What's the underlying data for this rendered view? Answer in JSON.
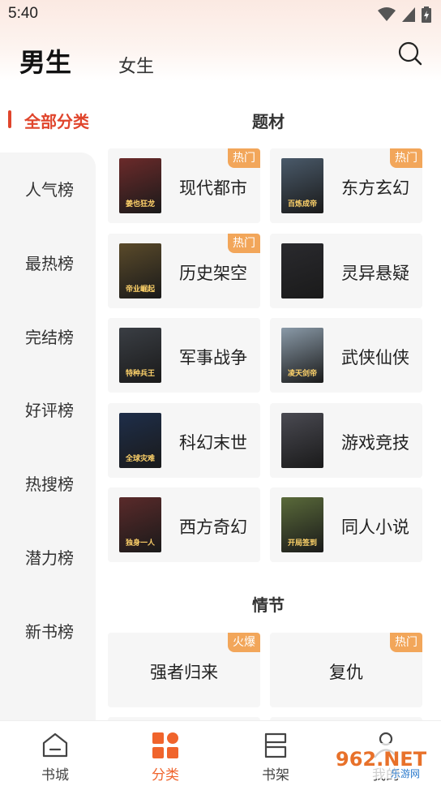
{
  "status_bar": {
    "time": "5:40"
  },
  "header": {
    "tab_male": "男生",
    "tab_female": "女生",
    "search_icon": "search-icon"
  },
  "sidebar": {
    "active": "全部分类",
    "items": [
      {
        "label": "人气榜"
      },
      {
        "label": "最热榜"
      },
      {
        "label": "完结榜"
      },
      {
        "label": "好评榜"
      },
      {
        "label": "热搜榜"
      },
      {
        "label": "潜力榜"
      },
      {
        "label": "新书榜"
      }
    ]
  },
  "themes": {
    "title": "题材",
    "cards": [
      {
        "name": "现代都市",
        "badge": "热门",
        "cover": "#6b2a2a",
        "cover_text": "姜也狂龙"
      },
      {
        "name": "东方玄幻",
        "badge": "热门",
        "cover": "#4a5a6a",
        "cover_text": "百炼成帝"
      },
      {
        "name": "历史架空",
        "badge": "热门",
        "cover": "#5a4a2a",
        "cover_text": "帝业崛起"
      },
      {
        "name": "灵异悬疑",
        "badge": "",
        "cover": "#2a2a2e",
        "cover_text": ""
      },
      {
        "name": "军事战争",
        "badge": "",
        "cover": "#3a3e44",
        "cover_text": "特种兵王"
      },
      {
        "name": "武侠仙侠",
        "badge": "",
        "cover": "#8a9aa8",
        "cover_text": "凌天剑帝"
      },
      {
        "name": "科幻末世",
        "badge": "",
        "cover": "#1e2e4a",
        "cover_text": "全球灾难"
      },
      {
        "name": "游戏竞技",
        "badge": "",
        "cover": "#4a4a52",
        "cover_text": ""
      },
      {
        "name": "西方奇幻",
        "badge": "",
        "cover": "#5a2a2a",
        "cover_text": "独身一人"
      },
      {
        "name": "同人小说",
        "badge": "",
        "cover": "#5a6a3a",
        "cover_text": "开局签到"
      }
    ]
  },
  "plots": {
    "title": "情节",
    "cards": [
      {
        "name": "强者归来",
        "badge": "火爆"
      },
      {
        "name": "复仇",
        "badge": "热门"
      }
    ]
  },
  "bottom_nav": {
    "items": [
      {
        "label": "书城",
        "icon": "home-icon"
      },
      {
        "label": "分类",
        "icon": "category-icon"
      },
      {
        "label": "书架",
        "icon": "bookshelf-icon"
      },
      {
        "label": "我的",
        "icon": "profile-icon"
      }
    ],
    "active_color": "#f0642c"
  },
  "watermark": {
    "text": "962.NET",
    "sub": "乐游网"
  }
}
